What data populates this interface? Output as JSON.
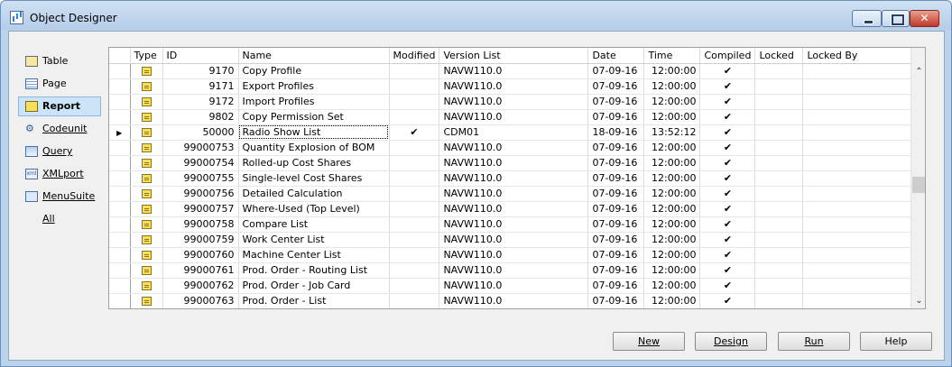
{
  "window": {
    "title": "Object Designer"
  },
  "sidebar": {
    "items": [
      {
        "label": "Table",
        "icon": "table-icon",
        "active": false
      },
      {
        "label": "Page",
        "icon": "page-icon",
        "active": false
      },
      {
        "label": "Report",
        "icon": "report-icon",
        "active": true
      },
      {
        "label": "Codeunit",
        "icon": "codeunit-icon",
        "active": false
      },
      {
        "label": "Query",
        "icon": "query-icon",
        "active": false
      },
      {
        "label": "XMLport",
        "icon": "xmlport-icon",
        "active": false
      },
      {
        "label": "MenuSuite",
        "icon": "menusuite-icon",
        "active": false
      },
      {
        "label": "All",
        "icon": "",
        "active": false
      }
    ]
  },
  "grid": {
    "columns": [
      "Type",
      "ID",
      "Name",
      "Modified",
      "Version List",
      "Date",
      "Time",
      "Compiled",
      "Locked",
      "Locked By"
    ],
    "rows": [
      {
        "id": "9170",
        "name": "Copy Profile",
        "modified": "",
        "version": "NAVW110.0",
        "date": "07-09-16",
        "time": "12:00:00",
        "compiled": "✔"
      },
      {
        "id": "9171",
        "name": "Export Profiles",
        "modified": "",
        "version": "NAVW110.0",
        "date": "07-09-16",
        "time": "12:00:00",
        "compiled": "✔"
      },
      {
        "id": "9172",
        "name": "Import Profiles",
        "modified": "",
        "version": "NAVW110.0",
        "date": "07-09-16",
        "time": "12:00:00",
        "compiled": "✔"
      },
      {
        "id": "9802",
        "name": "Copy Permission Set",
        "modified": "",
        "version": "NAVW110.0",
        "date": "07-09-16",
        "time": "12:00:00",
        "compiled": "✔"
      },
      {
        "id": "50000",
        "name": "Radio Show List",
        "modified": "✔",
        "version": "CDM01",
        "date": "18-09-16",
        "time": "13:52:12",
        "compiled": "✔",
        "current": true
      },
      {
        "id": "99000753",
        "name": "Quantity Explosion of BOM",
        "modified": "",
        "version": "NAVW110.0",
        "date": "07-09-16",
        "time": "12:00:00",
        "compiled": "✔"
      },
      {
        "id": "99000754",
        "name": "Rolled-up Cost Shares",
        "modified": "",
        "version": "NAVW110.0",
        "date": "07-09-16",
        "time": "12:00:00",
        "compiled": "✔"
      },
      {
        "id": "99000755",
        "name": "Single-level Cost Shares",
        "modified": "",
        "version": "NAVW110.0",
        "date": "07-09-16",
        "time": "12:00:00",
        "compiled": "✔"
      },
      {
        "id": "99000756",
        "name": "Detailed Calculation",
        "modified": "",
        "version": "NAVW110.0",
        "date": "07-09-16",
        "time": "12:00:00",
        "compiled": "✔"
      },
      {
        "id": "99000757",
        "name": "Where-Used (Top Level)",
        "modified": "",
        "version": "NAVW110.0",
        "date": "07-09-16",
        "time": "12:00:00",
        "compiled": "✔"
      },
      {
        "id": "99000758",
        "name": "Compare List",
        "modified": "",
        "version": "NAVW110.0",
        "date": "07-09-16",
        "time": "12:00:00",
        "compiled": "✔"
      },
      {
        "id": "99000759",
        "name": "Work Center List",
        "modified": "",
        "version": "NAVW110.0",
        "date": "07-09-16",
        "time": "12:00:00",
        "compiled": "✔"
      },
      {
        "id": "99000760",
        "name": "Machine Center List",
        "modified": "",
        "version": "NAVW110.0",
        "date": "07-09-16",
        "time": "12:00:00",
        "compiled": "✔"
      },
      {
        "id": "99000761",
        "name": "Prod. Order - Routing List",
        "modified": "",
        "version": "NAVW110.0",
        "date": "07-09-16",
        "time": "12:00:00",
        "compiled": "✔"
      },
      {
        "id": "99000762",
        "name": "Prod. Order - Job Card",
        "modified": "",
        "version": "NAVW110.0",
        "date": "07-09-16",
        "time": "12:00:00",
        "compiled": "✔"
      },
      {
        "id": "99000763",
        "name": "Prod. Order - List",
        "modified": "",
        "version": "NAVW110.0",
        "date": "07-09-16",
        "time": "12:00:00",
        "compiled": "✔"
      }
    ]
  },
  "buttons": {
    "new": "New",
    "design": "Design",
    "run": "Run",
    "help": "Help"
  },
  "colors": {
    "accent": "#cce4f7",
    "frame": "#bcd3ec",
    "close": "#c0392b"
  }
}
